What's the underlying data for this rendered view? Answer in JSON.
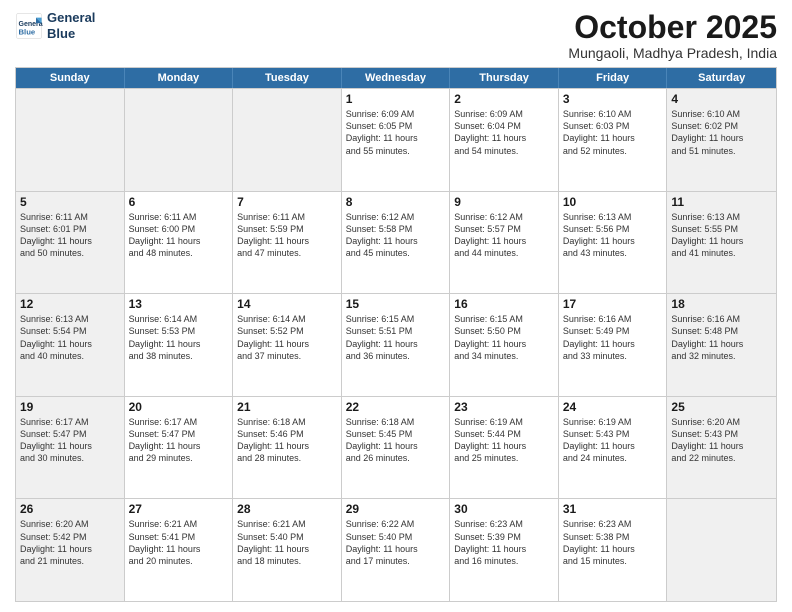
{
  "header": {
    "logo_line1": "General",
    "logo_line2": "Blue",
    "month_title": "October 2025",
    "location": "Mungaoli, Madhya Pradesh, India"
  },
  "weekdays": [
    "Sunday",
    "Monday",
    "Tuesday",
    "Wednesday",
    "Thursday",
    "Friday",
    "Saturday"
  ],
  "weeks": [
    [
      {
        "day": "",
        "info": "",
        "empty": true
      },
      {
        "day": "",
        "info": "",
        "empty": true
      },
      {
        "day": "",
        "info": "",
        "empty": true
      },
      {
        "day": "1",
        "info": "Sunrise: 6:09 AM\nSunset: 6:05 PM\nDaylight: 11 hours\nand 55 minutes."
      },
      {
        "day": "2",
        "info": "Sunrise: 6:09 AM\nSunset: 6:04 PM\nDaylight: 11 hours\nand 54 minutes."
      },
      {
        "day": "3",
        "info": "Sunrise: 6:10 AM\nSunset: 6:03 PM\nDaylight: 11 hours\nand 52 minutes."
      },
      {
        "day": "4",
        "info": "Sunrise: 6:10 AM\nSunset: 6:02 PM\nDaylight: 11 hours\nand 51 minutes."
      }
    ],
    [
      {
        "day": "5",
        "info": "Sunrise: 6:11 AM\nSunset: 6:01 PM\nDaylight: 11 hours\nand 50 minutes."
      },
      {
        "day": "6",
        "info": "Sunrise: 6:11 AM\nSunset: 6:00 PM\nDaylight: 11 hours\nand 48 minutes."
      },
      {
        "day": "7",
        "info": "Sunrise: 6:11 AM\nSunset: 5:59 PM\nDaylight: 11 hours\nand 47 minutes."
      },
      {
        "day": "8",
        "info": "Sunrise: 6:12 AM\nSunset: 5:58 PM\nDaylight: 11 hours\nand 45 minutes."
      },
      {
        "day": "9",
        "info": "Sunrise: 6:12 AM\nSunset: 5:57 PM\nDaylight: 11 hours\nand 44 minutes."
      },
      {
        "day": "10",
        "info": "Sunrise: 6:13 AM\nSunset: 5:56 PM\nDaylight: 11 hours\nand 43 minutes."
      },
      {
        "day": "11",
        "info": "Sunrise: 6:13 AM\nSunset: 5:55 PM\nDaylight: 11 hours\nand 41 minutes."
      }
    ],
    [
      {
        "day": "12",
        "info": "Sunrise: 6:13 AM\nSunset: 5:54 PM\nDaylight: 11 hours\nand 40 minutes."
      },
      {
        "day": "13",
        "info": "Sunrise: 6:14 AM\nSunset: 5:53 PM\nDaylight: 11 hours\nand 38 minutes."
      },
      {
        "day": "14",
        "info": "Sunrise: 6:14 AM\nSunset: 5:52 PM\nDaylight: 11 hours\nand 37 minutes."
      },
      {
        "day": "15",
        "info": "Sunrise: 6:15 AM\nSunset: 5:51 PM\nDaylight: 11 hours\nand 36 minutes."
      },
      {
        "day": "16",
        "info": "Sunrise: 6:15 AM\nSunset: 5:50 PM\nDaylight: 11 hours\nand 34 minutes."
      },
      {
        "day": "17",
        "info": "Sunrise: 6:16 AM\nSunset: 5:49 PM\nDaylight: 11 hours\nand 33 minutes."
      },
      {
        "day": "18",
        "info": "Sunrise: 6:16 AM\nSunset: 5:48 PM\nDaylight: 11 hours\nand 32 minutes."
      }
    ],
    [
      {
        "day": "19",
        "info": "Sunrise: 6:17 AM\nSunset: 5:47 PM\nDaylight: 11 hours\nand 30 minutes."
      },
      {
        "day": "20",
        "info": "Sunrise: 6:17 AM\nSunset: 5:47 PM\nDaylight: 11 hours\nand 29 minutes."
      },
      {
        "day": "21",
        "info": "Sunrise: 6:18 AM\nSunset: 5:46 PM\nDaylight: 11 hours\nand 28 minutes."
      },
      {
        "day": "22",
        "info": "Sunrise: 6:18 AM\nSunset: 5:45 PM\nDaylight: 11 hours\nand 26 minutes."
      },
      {
        "day": "23",
        "info": "Sunrise: 6:19 AM\nSunset: 5:44 PM\nDaylight: 11 hours\nand 25 minutes."
      },
      {
        "day": "24",
        "info": "Sunrise: 6:19 AM\nSunset: 5:43 PM\nDaylight: 11 hours\nand 24 minutes."
      },
      {
        "day": "25",
        "info": "Sunrise: 6:20 AM\nSunset: 5:43 PM\nDaylight: 11 hours\nand 22 minutes."
      }
    ],
    [
      {
        "day": "26",
        "info": "Sunrise: 6:20 AM\nSunset: 5:42 PM\nDaylight: 11 hours\nand 21 minutes."
      },
      {
        "day": "27",
        "info": "Sunrise: 6:21 AM\nSunset: 5:41 PM\nDaylight: 11 hours\nand 20 minutes."
      },
      {
        "day": "28",
        "info": "Sunrise: 6:21 AM\nSunset: 5:40 PM\nDaylight: 11 hours\nand 18 minutes."
      },
      {
        "day": "29",
        "info": "Sunrise: 6:22 AM\nSunset: 5:40 PM\nDaylight: 11 hours\nand 17 minutes."
      },
      {
        "day": "30",
        "info": "Sunrise: 6:23 AM\nSunset: 5:39 PM\nDaylight: 11 hours\nand 16 minutes."
      },
      {
        "day": "31",
        "info": "Sunrise: 6:23 AM\nSunset: 5:38 PM\nDaylight: 11 hours\nand 15 minutes."
      },
      {
        "day": "",
        "info": "",
        "empty": true
      }
    ]
  ]
}
